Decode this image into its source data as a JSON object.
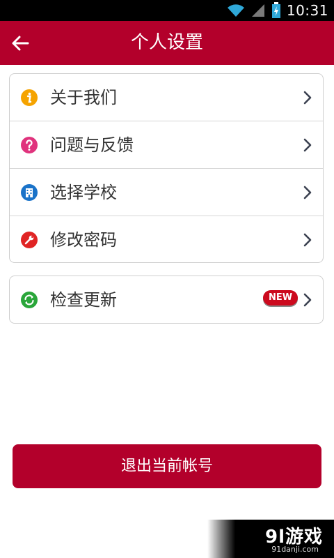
{
  "status_bar": {
    "time": "10:31"
  },
  "app_bar": {
    "title": "个人设置"
  },
  "menu_group_1": [
    {
      "label": "关于我们",
      "icon": "info-icon",
      "icon_color": "#f5a300"
    },
    {
      "label": "问题与反馈",
      "icon": "question-icon",
      "icon_color": "#e0337d"
    },
    {
      "label": "选择学校",
      "icon": "building-icon",
      "icon_color": "#1a73c9"
    },
    {
      "label": "修改密码",
      "icon": "wrench-icon",
      "icon_color": "#e02424"
    }
  ],
  "menu_group_2": [
    {
      "label": "检查更新",
      "icon": "refresh-icon",
      "icon_color": "#2aa63a",
      "badge": "NEW"
    }
  ],
  "logout_label": "退出当前帐号",
  "watermark": {
    "main": "9l游戏",
    "sub": "91danji.com"
  },
  "colors": {
    "accent": "#b3002b",
    "badge": "#cc0a1e"
  }
}
